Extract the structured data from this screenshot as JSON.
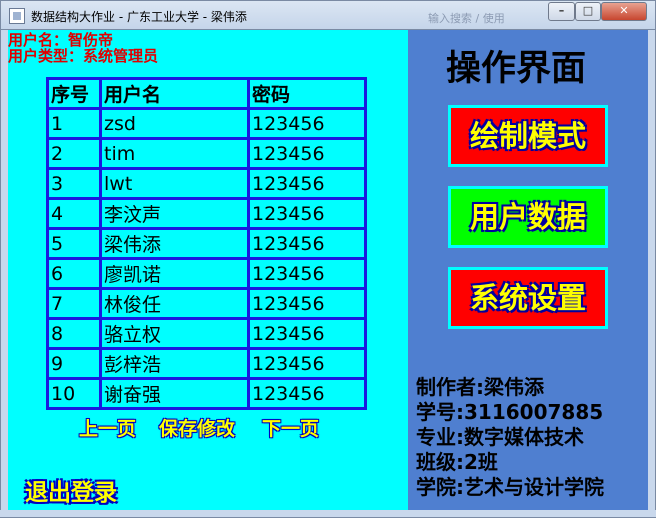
{
  "window": {
    "title": "数据结构大作业 - 广东工业大学 - 梁伟添",
    "ghost_text": "输入搜索 / 使用",
    "min_label": "–",
    "max_label": "□",
    "close_label": "✕"
  },
  "user": {
    "name_line": "用户名：智伤帝",
    "type_line": "用户类型：系统管理员"
  },
  "table": {
    "headers": [
      "序号",
      "用户名",
      "密码"
    ],
    "rows": [
      [
        "1",
        "zsd",
        "123456"
      ],
      [
        "2",
        "tim",
        "123456"
      ],
      [
        "3",
        "lwt",
        "123456"
      ],
      [
        "4",
        "李汶声",
        "123456"
      ],
      [
        "5",
        "梁伟添",
        "123456"
      ],
      [
        "6",
        "廖凯诺",
        "123456"
      ],
      [
        "7",
        "林俊任",
        "123456"
      ],
      [
        "8",
        "骆立权",
        "123456"
      ],
      [
        "9",
        "彭梓浩",
        "123456"
      ],
      [
        "10",
        "谢奋强",
        "123456"
      ]
    ]
  },
  "pager": {
    "prev": "上一页",
    "save": "保存修改",
    "next": "下一页"
  },
  "logout": "退出登录",
  "panel": {
    "title": "操作界面",
    "buttons": [
      {
        "label": "绘制模式",
        "color": "#ff0000"
      },
      {
        "label": "用户数据",
        "color": "#00ff00"
      },
      {
        "label": "系统设置",
        "color": "#ff0000"
      }
    ]
  },
  "author": {
    "name": "制作者:梁伟添",
    "id": "学号:3116007885",
    "major": "专业:数字媒体技术",
    "class": "班级:2班",
    "college": "学院:艺术与设计学院"
  },
  "colors": {
    "left_bg": "#00ffff",
    "right_bg": "#4f7fd0",
    "table_border": "#1a1adf",
    "accent_text": "#ffff00"
  }
}
